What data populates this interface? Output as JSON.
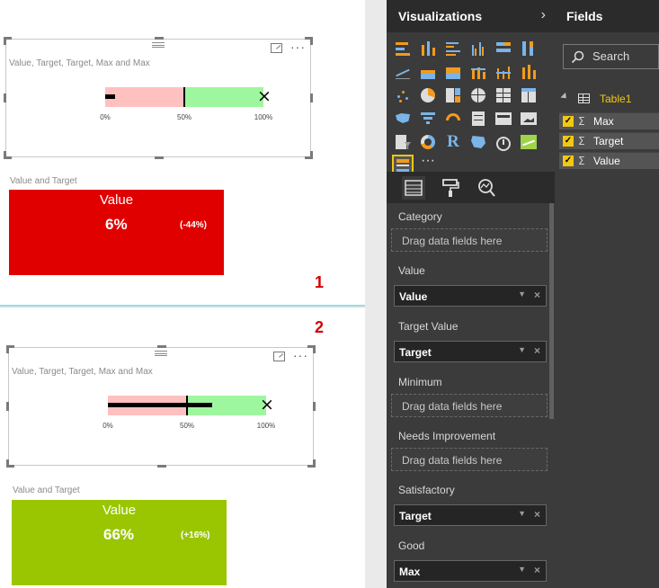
{
  "panel1": {
    "bullet_title": "Value, Target, Target, Max and Max",
    "ticks": [
      "0%",
      "50%",
      "100%"
    ],
    "value_fraction": 0.06,
    "target_fraction": 0.5,
    "max_fraction": 1.0,
    "card_title": "Value and Target",
    "card_label": "Value",
    "card_value": "6%",
    "card_delta": "(-44%)",
    "card_color": "#e00000",
    "step": "1"
  },
  "panel2": {
    "bullet_title": "Value, Target, Target, Max and Max",
    "ticks": [
      "0%",
      "50%",
      "100%"
    ],
    "value_fraction": 0.66,
    "target_fraction": 0.5,
    "max_fraction": 1.0,
    "card_title": "Value and Target",
    "card_label": "Value",
    "card_value": "66%",
    "card_delta": "(+16%)",
    "card_color": "#99c600",
    "step": "2"
  },
  "colors": {
    "below_target_band": "#ffc0c0",
    "above_target_band": "#9ef79e",
    "accent": "#f2c811"
  },
  "visualizations": {
    "title": "Visualizations",
    "chevron": "chevron-right-icon",
    "wells": [
      {
        "label": "Category",
        "placeholder": "Drag data fields here",
        "field": null
      },
      {
        "label": "Value",
        "placeholder": null,
        "field": "Value"
      },
      {
        "label": "Target Value",
        "placeholder": null,
        "field": "Target"
      },
      {
        "label": "Minimum",
        "placeholder": "Drag data fields here",
        "field": null
      },
      {
        "label": "Needs Improvement",
        "placeholder": "Drag data fields here",
        "field": null
      },
      {
        "label": "Satisfactory",
        "placeholder": null,
        "field": "Target"
      },
      {
        "label": "Good",
        "placeholder": null,
        "field": "Max"
      }
    ],
    "tabs": [
      "fields-tab-icon",
      "format-paint-roller-icon",
      "analytics-magnifier-icon"
    ]
  },
  "fields": {
    "title": "Fields",
    "search_placeholder": "Search",
    "table_name": "Table1",
    "items": [
      {
        "name": "Max",
        "checked": true
      },
      {
        "name": "Target",
        "checked": true
      },
      {
        "name": "Value",
        "checked": true
      }
    ]
  }
}
